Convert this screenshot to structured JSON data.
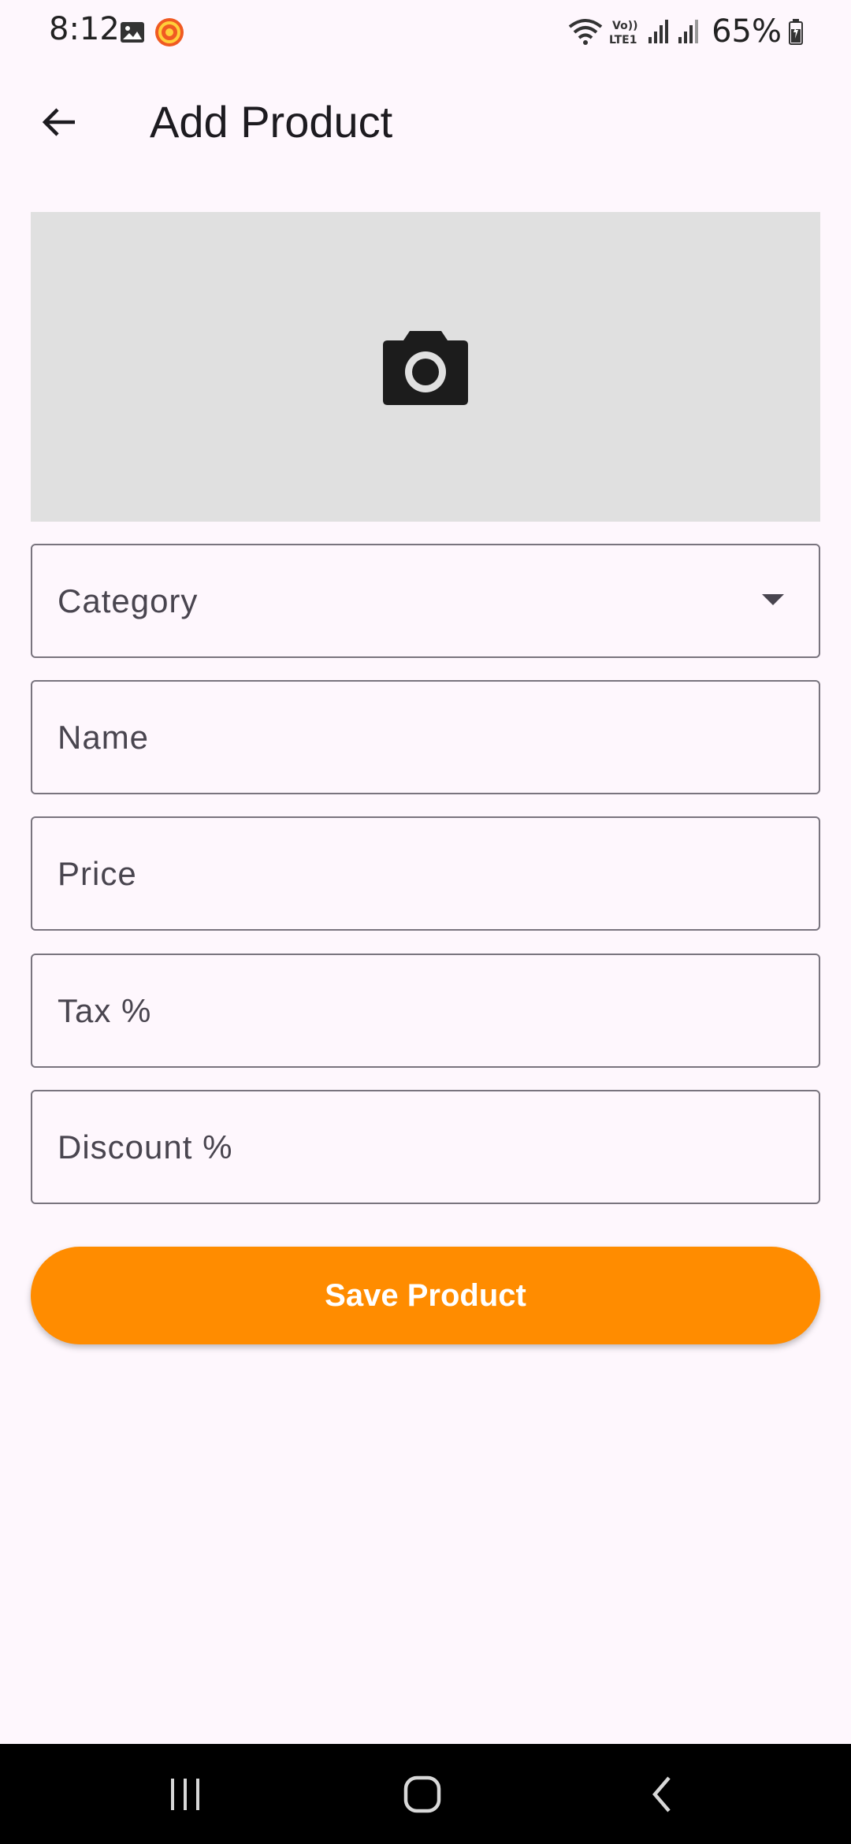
{
  "status_bar": {
    "time": "8:12",
    "battery": "65%"
  },
  "app_bar": {
    "title": "Add Product",
    "back_icon": "arrow-back-icon"
  },
  "image_picker": {
    "icon": "camera-icon",
    "background": "#e0e0e0"
  },
  "form": {
    "category_label": "Category",
    "name_label": "Name",
    "price_label": "Price",
    "tax_label": "Tax %",
    "discount_label": "Discount %"
  },
  "save_button": {
    "label": "Save Product",
    "color": "#ff8c00"
  },
  "nav_bar": {
    "recents_icon": "recents-icon",
    "home_icon": "home-icon",
    "back_icon": "nav-back-icon"
  }
}
